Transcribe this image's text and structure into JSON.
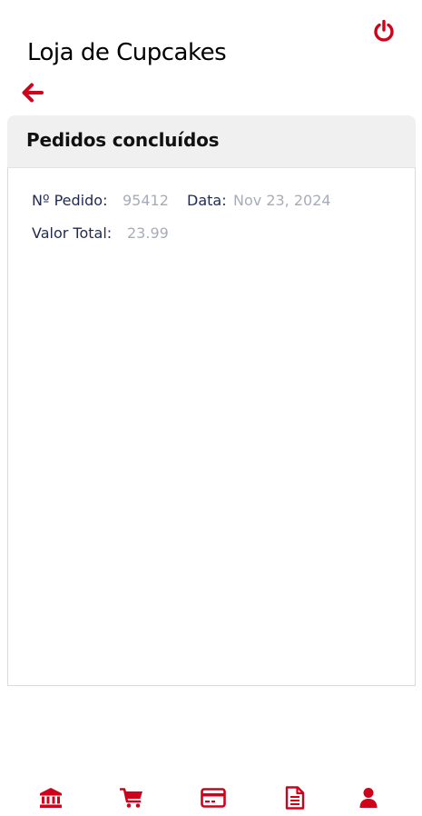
{
  "app": {
    "title": "Loja de Cupcakes"
  },
  "icons": {
    "logout": "power-icon",
    "back": "arrow-left-icon"
  },
  "colors": {
    "accent": "#d0021b",
    "label": "#1f2a55",
    "value": "#a6adb8",
    "header_bg": "#f0f0f0"
  },
  "panel": {
    "title": "Pedidos concluídos"
  },
  "orders": [
    {
      "number_label": "Nº Pedido:",
      "number": "95412",
      "date_label": "Data:",
      "date": "Nov 23, 2024",
      "total_label": "Valor Total:",
      "total": "23.99"
    }
  ],
  "bottom_nav": [
    {
      "icon": "bank-icon"
    },
    {
      "icon": "cart-icon"
    },
    {
      "icon": "credit-card-icon"
    },
    {
      "icon": "document-icon"
    },
    {
      "icon": "user-icon"
    }
  ]
}
